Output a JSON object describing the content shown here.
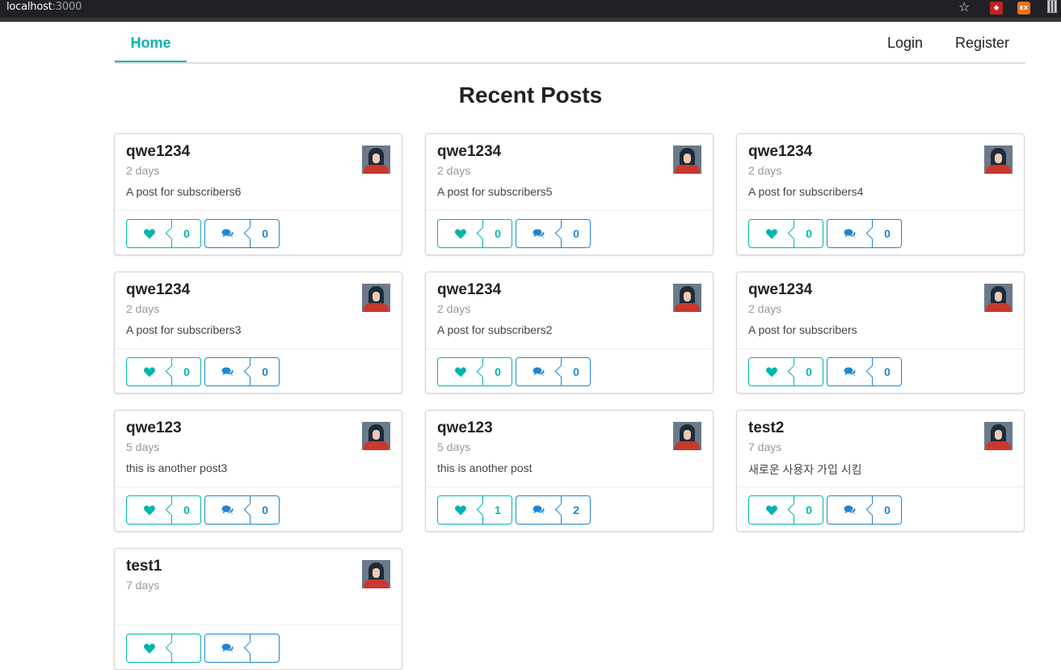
{
  "browser": {
    "host": "localhost",
    "port": ":3000",
    "star_icon": "star-icon",
    "extensions": [
      "pdf-extension-icon",
      "ex-extension-icon"
    ]
  },
  "nav": {
    "home": "Home",
    "login": "Login",
    "register": "Register"
  },
  "page_title": "Recent Posts",
  "colors": {
    "accent_teal": "#00b5ad",
    "accent_blue": "#2185d0"
  },
  "posts": [
    {
      "user": "qwe1234",
      "time": "2 days",
      "body": "A post for subscribers6",
      "likes": "0",
      "comments": "0"
    },
    {
      "user": "qwe1234",
      "time": "2 days",
      "body": "A post for subscribers5",
      "likes": "0",
      "comments": "0"
    },
    {
      "user": "qwe1234",
      "time": "2 days",
      "body": "A post for subscribers4",
      "likes": "0",
      "comments": "0"
    },
    {
      "user": "qwe1234",
      "time": "2 days",
      "body": "A post for subscribers3",
      "likes": "0",
      "comments": "0"
    },
    {
      "user": "qwe1234",
      "time": "2 days",
      "body": "A post for subscribers2",
      "likes": "0",
      "comments": "0"
    },
    {
      "user": "qwe1234",
      "time": "2 days",
      "body": "A post for subscribers",
      "likes": "0",
      "comments": "0"
    },
    {
      "user": "qwe123",
      "time": "5 days",
      "body": "this is another post3",
      "likes": "0",
      "comments": "0"
    },
    {
      "user": "qwe123",
      "time": "5 days",
      "body": "this is another post",
      "likes": "1",
      "comments": "2"
    },
    {
      "user": "test2",
      "time": "7 days",
      "body": "새로운 사용자 가입 시킴",
      "likes": "0",
      "comments": "0"
    },
    {
      "user": "test1",
      "time": "7 days",
      "body": "",
      "likes": "",
      "comments": ""
    }
  ]
}
